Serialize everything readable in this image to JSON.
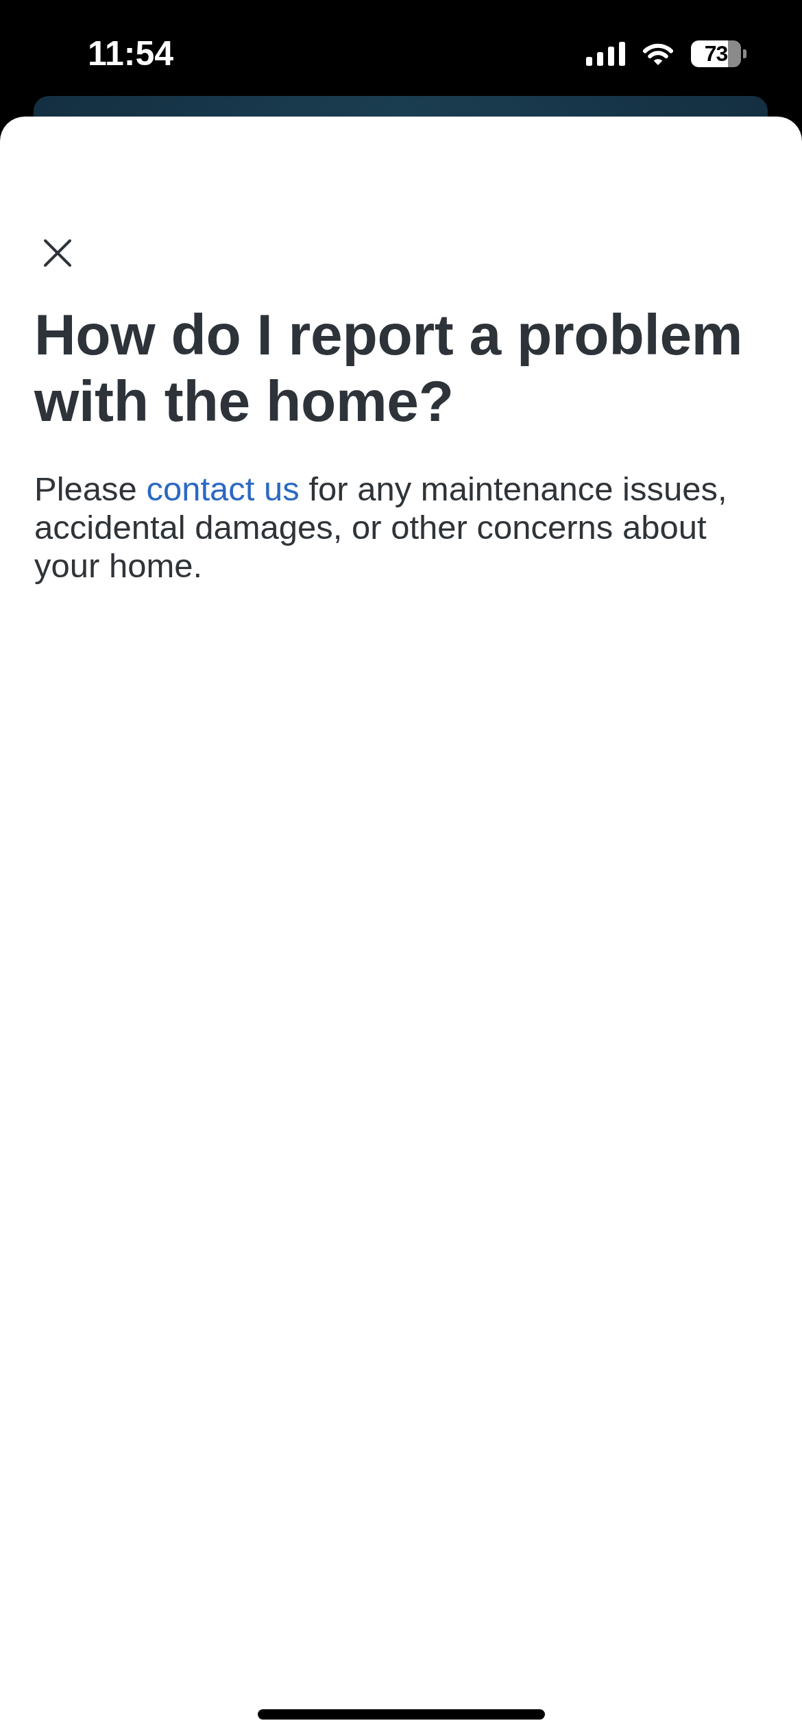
{
  "status_bar": {
    "time": "11:54",
    "battery": "73"
  },
  "sheet": {
    "title": "How do I report a problem with the home?",
    "body": [
      {
        "kind": "text",
        "text": "Please "
      },
      {
        "kind": "link",
        "text": "contact us"
      },
      {
        "kind": "text",
        "text": " for any maintenance issues, accidental damages, or other concerns about your home."
      }
    ]
  }
}
